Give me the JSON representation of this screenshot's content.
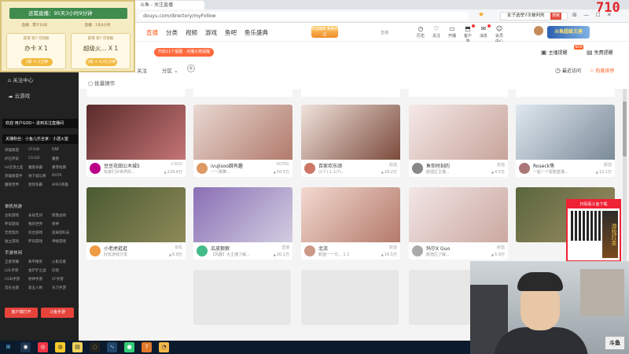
{
  "browser": {
    "tab_title": "斗鱼 - 关注直播",
    "url": "douyu.com/directory/myFollow",
    "search_text": "女子选举7次被判刑",
    "search_button": "搜索",
    "counter": "710"
  },
  "overlay": {
    "title": "还需直播：95天3小时9分钟",
    "tabs": [
      "直播：累计10天",
      "直播：1天4小时"
    ],
    "cards": [
      {
        "title": "获得 等7 可领取",
        "name": "办卡 X 1",
        "price": "1新 = 1分钟"
      },
      {
        "title": "获得 等7 可领取",
        "name": "超级火... X 1",
        "price": "1新 = 0.01分钟"
      }
    ]
  },
  "header": {
    "nav": [
      "直播",
      "分类",
      "视频",
      "游戏",
      "鱼吧",
      "鱼乐盛典"
    ],
    "promo": "年度巅峰 赛事开启",
    "login_tag": "直播",
    "icons": [
      {
        "name": "history-icon",
        "glyph": "◷",
        "label": "历史"
      },
      {
        "name": "follow-icon",
        "glyph": "♡",
        "label": "关注"
      },
      {
        "name": "broadcast-icon",
        "glyph": "▭",
        "label": "开播"
      },
      {
        "name": "client-icon",
        "glyph": "⬒",
        "label": "客户端"
      },
      {
        "name": "message-icon",
        "glyph": "✉",
        "label": "消息"
      },
      {
        "name": "user-center-icon",
        "glyph": "☺",
        "label": "会员中心"
      }
    ],
    "banner": "斗鱼超级王座"
  },
  "sub_header": {
    "red_pill": "开启11个提醒 · 点播大佬提醒",
    "filter_follow": "关注",
    "filter_partition": "分区",
    "manage": "批量操作",
    "btn_pin": "主播提醒",
    "btn_record": "最近访问",
    "btn_hot": "热度排序",
    "btn_free": "免费提醒",
    "tiny_badge": "NEW"
  },
  "sidebar": {
    "top_items": [
      "关注中心",
      "云游戏"
    ],
    "chat": [
      "欢迎 用户GOD~ 进到关注直播间",
      "关播粉丝：小鱼儿乐全家：小透火鉴"
    ],
    "section1": [
      "英雄联盟",
      "CF/HD",
      "DNF",
      "炉石传说",
      "CS:GO",
      "魔兽",
      "lol云顶之奕",
      "魔兽争霸",
      "暴雪经典",
      "英雄联盟手",
      "地下城与勇",
      "DOTA",
      "魔兽世界",
      "星际争霸",
      "APEX英雄"
    ],
    "section2_head": "单机热游",
    "section2": [
      "主机游戏",
      "永劫无间",
      "刺激战场",
      "怀旧游戏",
      "我的世界",
      "原神",
      "无畏契约",
      "综合游戏",
      "逃离塔科夫",
      "独立游戏",
      "怀旧游戏",
      "神秘游戏"
    ],
    "section3_head": "手游休闲",
    "section3": [
      "王者荣耀",
      "和平精英",
      "火影忍者",
      "LOL手游",
      "金铲铲之战",
      "幻塔",
      "COD手游",
      "原神手游",
      "CF手游",
      "音乐主题",
      "第五人格",
      "天刀手游"
    ],
    "btn_client": "客户端打开",
    "btn_download": "斗鱼手游"
  },
  "cards": [
    {
      "name": "豆豆花田公木城5",
      "sub": "玩家们对世界的...",
      "tag": "CSGO",
      "hot": "129.4万"
    },
    {
      "name": "ivuJisoo跳有趣",
      "sub": "一一跳舞...",
      "tag": "DOTAL",
      "hot": "50.5万"
    },
    {
      "name": "百家欢乐颂",
      "sub": "(1个) 1.1(7)...",
      "tag": "颜值",
      "hot": "18.2万"
    },
    {
      "name": "鱼你时刻的",
      "sub": "颜值区主播...",
      "tag": "颜值",
      "hot": "4.5万"
    },
    {
      "name": "Roseck等",
      "sub": "一起一个看剧直播...",
      "tag": "颜值",
      "hot": "12.1万"
    },
    {
      "name": "小老虎逛逛",
      "sub": "好玩游戏分享",
      "tag": "单机",
      "hot": "6.8万"
    },
    {
      "name": "瓜皮狼狼",
      "sub": "【风趣】大主播了解...",
      "tag": "直播",
      "hot": "20.1万"
    },
    {
      "name": "北流",
      "sub": "颜值一一元... 1 1",
      "tag": "颜值",
      "hot": "16.5万"
    },
    {
      "name": "玛尔X Guo",
      "sub": "颜值区了解...",
      "tag": "颜值",
      "hot": "5.9万"
    },
    {
      "name": "",
      "sub": "",
      "tag": "",
      "hot": ""
    }
  ],
  "qr_ad": {
    "head": "扫码看斗鱼下载",
    "side": "游戏打金"
  },
  "webcam": {
    "logo": "斗鱼"
  },
  "colors": {
    "accent": "#ff5d23",
    "sidebar": "#222222",
    "content_bg": "#f4f4f4"
  }
}
